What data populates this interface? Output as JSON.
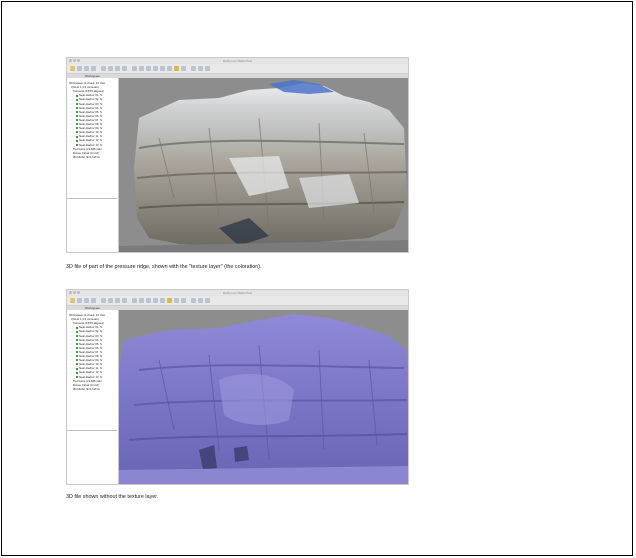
{
  "figure1": {
    "window_title": "Reference Reflectivity",
    "tab_label": "Workspace",
    "viewport_label": "",
    "tree": [
      "Workspace (1 chunk, 10 cam",
      "Chunk 1 (13 cameras)",
      "Cameras (15/15 aligned)",
      "Near-Harbor 01, N",
      "Near-Harbor 02, N",
      "Near-Harbor 03, N",
      "Near-Harbor 04, N",
      "Near-Harbor 05, N",
      "Near-Harbor 06, N",
      "Near-Harbor 07, N",
      "Near-Harbor 08, N",
      "Near-Harbor 09, N",
      "Near-Harbor 10, N",
      "Near-Harbor 11, N",
      "Near-Harbor 12, N",
      "Near-Harbor 13, N",
      "Tie Points (21,485 poin",
      "Dense Cloud (3.1 M)",
      "3D Model (974,116 fa"
    ],
    "caption": "3D file of part of the pressure ridge, shown with the \"texture layer\" (the coloration)."
  },
  "figure2": {
    "window_title": "Reference Reflectivity",
    "tab_label": "Workspace",
    "tree": [
      "Workspace (1 chunk, 10 cam",
      "Chunk 1 (13 cameras)",
      "Cameras (15/15 aligned)",
      "Near-Harbor 01, N",
      "Near-Harbor 02, N",
      "Near-Harbor 03, N",
      "Near-Harbor 04, N",
      "Near-Harbor 05, N",
      "Near-Harbor 06, N",
      "Near-Harbor 07, N",
      "Near-Harbor 08, N",
      "Near-Harbor 09, N",
      "Near-Harbor 10, N",
      "Near-Harbor 11, N",
      "Near-Harbor 12, N",
      "Near-Harbor 13, N",
      "Tie Points (21,485 poin",
      "Dense Cloud (3.1 M)",
      "3D Model (974,116 fa"
    ],
    "caption": "3D file shown without the texture layer."
  },
  "colors": {
    "viewport_bg": "#8d8d8d",
    "textured_model": "#bdb8ad",
    "shaded_model": "#7d78c8",
    "checkbox": "#3c9a3c"
  }
}
